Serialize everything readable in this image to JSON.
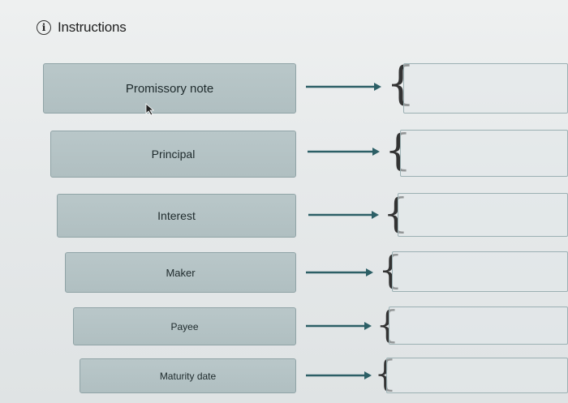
{
  "header": {
    "icon": "info-icon",
    "title": "Instructions"
  },
  "rows": [
    {
      "term": "Promissory note"
    },
    {
      "term": "Principal"
    },
    {
      "term": "Interest"
    },
    {
      "term": "Maker"
    },
    {
      "term": "Payee"
    },
    {
      "term": "Maturity date"
    }
  ],
  "colors": {
    "term_fill": "#b5c3c5",
    "arrow": "#2c5f66",
    "zone_border": "#9bb0b3"
  }
}
